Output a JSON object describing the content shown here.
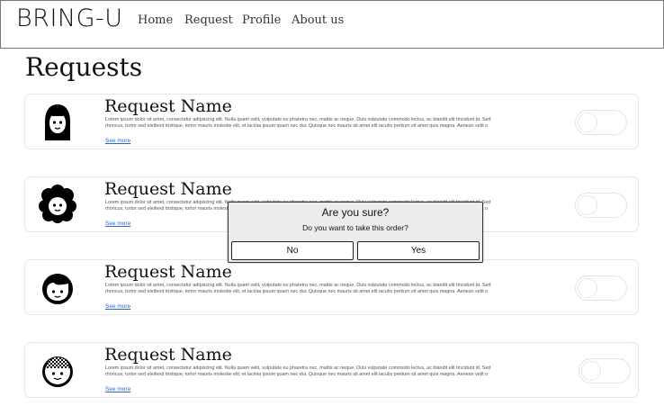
{
  "navbar": {
    "brand": "BRING-U",
    "links": [
      "Home",
      "Request",
      "Profile",
      "About us"
    ]
  },
  "page_title": "Requests",
  "requests": [
    {
      "name": "Request Name",
      "description": "Lorem ipsum dolor sit amet, consectetur adipiscing elit. Nulla quam velit, vulputate eu pharetra nec, mattis ac neque. Duis vulputate commodo lectus, ac blandit elit tincidunt id. Sed rhoncus, tortor sed eleifend tristique, tortor mauris molestie elit, et lacinia ipsum quam nec dui. Quisque nec mauris sit amet elit iaculis pretium sit amet quis magna. Aenean velit o",
      "see_more": "See more",
      "avatar_icon": "female-avatar-icon"
    },
    {
      "name": "Request Name",
      "description": "Lorem ipsum dolor sit amet, consectetur adipiscing elit. Nulla quam velit, vulputate eu pharetra nec, mattis ac neque. Duis vulputate commodo lectus, ac blandit elit tincidunt id. Sed rhoncus, tortor sed eleifend tristique, tortor mauris molestie elit, et lacinia ipsum quam nec dui. Quisque nec mauris sit amet elit iaculis pretium sit amet quis magna. Aenean velit o",
      "see_more": "See more",
      "avatar_icon": "curly-hair-avatar-icon"
    },
    {
      "name": "Request Name",
      "description": "Lorem ipsum dolor sit amet, consectetur adipiscing elit. Nulla quam velit, vulputate eu pharetra nec, mattis ac neque. Duis vulputate commodo lectus, ac blandit elit tincidunt id. Sed rhoncus, tortor sed eleifend tristique, tortor mauris molestie elit, et lacinia ipsum quam nec dui. Quisque nec mauris sit amet elit iaculis pretium sit amet quis magna. Aenean velit o",
      "see_more": "See more",
      "avatar_icon": "boy-avatar-icon"
    },
    {
      "name": "Request Name",
      "description": "Lorem ipsum dolor sit amet, consectetur adipiscing elit. Nulla quam velit, vulputate eu pharetra nec, mattis ac neque. Duis vulputate commodo lectus, ac blandit elit tincidunt id. Sed rhoncus, tortor sed eleifend tristique, tortor mauris molestie elit, et lacinia ipsum quam nec dui. Quisque nec mauris sit amet elit iaculis pretium sit amet quis magna. Aenean velit o",
      "see_more": "See more",
      "avatar_icon": "checkered-hat-avatar-icon"
    }
  ],
  "modal": {
    "title": "Are you sure?",
    "message": "Do you want to take this order?",
    "no_label": "No",
    "yes_label": "Yes"
  },
  "colors": {
    "link": "#2f64c8",
    "modal_bg": "#ececec",
    "card_border": "#e6e6e6"
  }
}
